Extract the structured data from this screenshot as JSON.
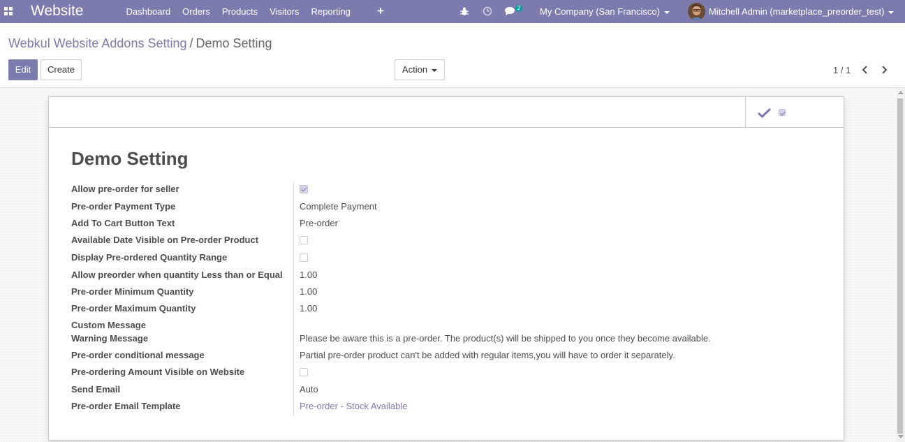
{
  "navbar": {
    "apps_icon": "apps-grid-icon",
    "brand": "Website",
    "menu": [
      "Dashboard",
      "Orders",
      "Products",
      "Visitors",
      "Reporting"
    ],
    "add_icon": "plus-icon",
    "debug_icon": "bug-icon",
    "activity_icon": "clock-icon",
    "messages_icon": "chat-icon",
    "messages_count": "2",
    "company": "My Company (San Francisco)",
    "user": "Mitchell Admin (marketplace_preorder_test)"
  },
  "breadcrumb": {
    "parent": "Webkul Website Addons Setting",
    "separator": "/",
    "current": "Demo Setting"
  },
  "buttons": {
    "edit": "Edit",
    "create": "Create",
    "action": "Action"
  },
  "pager": {
    "value": "1 / 1"
  },
  "record": {
    "title": "Demo Setting",
    "fields": [
      {
        "label": "Allow pre-order for seller",
        "type": "checkbox",
        "checked": true
      },
      {
        "label": "Pre-order Payment Type",
        "type": "text",
        "value": "Complete Payment"
      },
      {
        "label": "Add To Cart Button Text",
        "type": "text",
        "value": "Pre-order"
      },
      {
        "label": "Available Date Visible on Pre-order Product",
        "type": "checkbox",
        "checked": false
      },
      {
        "label": "Display Pre-ordered Quantity Range",
        "type": "checkbox",
        "checked": false
      },
      {
        "label": "Allow preorder when quantity Less than or Equal",
        "type": "text",
        "value": "1.00"
      },
      {
        "label": "Pre-order Minimum Quantity",
        "type": "text",
        "value": "1.00"
      },
      {
        "label": "Pre-order Maximum Quantity",
        "type": "text",
        "value": "1.00"
      },
      {
        "label": "Custom Message",
        "type": "text",
        "value": ""
      },
      {
        "label": "Warning Message",
        "type": "text",
        "value": "Please be aware this is a pre-order. The product(s) will be shipped to you once they become available."
      },
      {
        "label": "Pre-order conditional message",
        "type": "text",
        "value": "Partial pre-order product can't be added with regular items,you will have to order it separately."
      },
      {
        "label": "Pre-ordering Amount Visible on Website",
        "type": "checkbox",
        "checked": false
      },
      {
        "label": "Send Email",
        "type": "text",
        "value": "Auto"
      },
      {
        "label": "Pre-order Email Template",
        "type": "link",
        "value": "Pre-order - Stock Available"
      }
    ]
  },
  "status": {
    "active_icon": "check-icon",
    "active_checked": true
  },
  "colors": {
    "brand": "#7c7bad",
    "text": "#4c4c4c"
  }
}
